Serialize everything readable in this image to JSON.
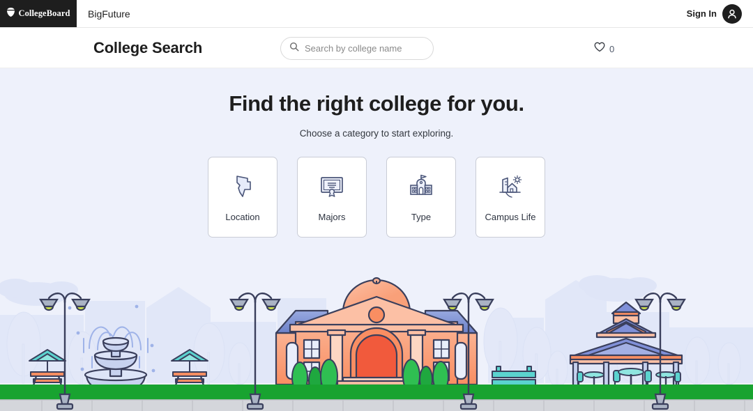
{
  "topbar": {
    "logo_text": "CollegeBoard",
    "logo_icon": "acorn-icon",
    "brand": "BigFuture",
    "signin_label": "Sign In",
    "avatar_icon": "user-avatar-icon"
  },
  "searchbar": {
    "page_title": "College Search",
    "search_icon": "search-icon",
    "search_value": "",
    "search_placeholder": "Search by college name",
    "favorites_icon": "heart-icon",
    "favorites_count": "0"
  },
  "hero": {
    "heading": "Find the right college for you.",
    "subheading": "Choose a category to start exploring.",
    "background_color": "#eef1fb",
    "cards": [
      {
        "label": "Location",
        "icon": "map-state-icon"
      },
      {
        "label": "Majors",
        "icon": "diploma-icon"
      },
      {
        "label": "Type",
        "icon": "school-building-icon"
      },
      {
        "label": "Campus Life",
        "icon": "tent-sun-icon"
      }
    ]
  },
  "illustration": {
    "name": "campus-park-illustration",
    "elements": [
      "fountain",
      "picnic-table-left",
      "picnic-table-right",
      "lamp-post",
      "main-campus-building",
      "park-bench",
      "gazebo-pavilion",
      "trees",
      "clouds",
      "city-skyline",
      "grass-strip",
      "sidewalk"
    ],
    "colors": {
      "sky": "#eef1fb",
      "skyline": "#dfe5f7",
      "building": "#f98e62",
      "building_light": "#fbb393",
      "roof": "#7b8fd4",
      "door": "#f15a3c",
      "grass": "#18a330",
      "sidewalk": "#d4d6db",
      "stroke": "#3a3f5c",
      "teal": "#5bd3cf",
      "lamp_glow": "#d4e84a"
    }
  }
}
